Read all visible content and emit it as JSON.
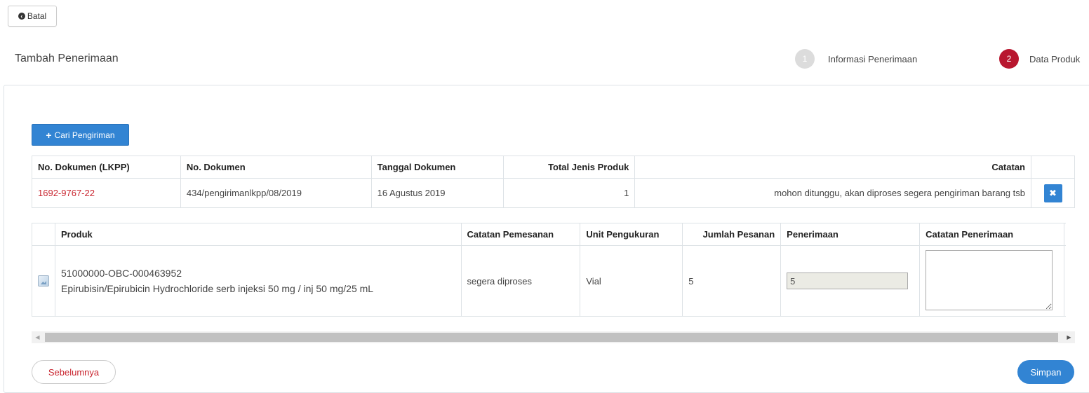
{
  "toolbar": {
    "back_label": "Batal"
  },
  "page": {
    "title": "Tambah Penerimaan"
  },
  "steps": [
    {
      "number": "1",
      "label": "Informasi Penerimaan"
    },
    {
      "number": "2",
      "label": "Data Produk"
    }
  ],
  "search_button": {
    "label": "Cari Pengiriman"
  },
  "documents_table": {
    "headers": [
      "No. Dokumen (LKPP)",
      "No. Dokumen",
      "Tanggal Dokumen",
      "Total Jenis Produk",
      "Catatan"
    ],
    "rows": [
      {
        "lkpp": "1692-9767-22",
        "doc_no": "434/pengirimanlkpp/08/2019",
        "date": "16 Agustus 2019",
        "total": "1",
        "note": "mohon ditunggu, akan diproses segera pengiriman barang tsb"
      }
    ]
  },
  "products_table": {
    "headers": [
      "Produk",
      "Catatan Pemesanan",
      "Unit Pengukuran",
      "Jumlah Pesanan",
      "Penerimaan",
      "Catatan Penerimaan"
    ],
    "rows": [
      {
        "code": "51000000-OBC-000463952",
        "name": "Epirubisin/Epirubicin Hydrochloride serb injeksi 50 mg / inj 50 mg/25 mL",
        "order_note": "segera diproses",
        "unit": "Vial",
        "qty": "5",
        "received": "5",
        "receive_note": ""
      }
    ]
  },
  "footer": {
    "prev_label": "Sebelumnya",
    "save_label": "Simpan"
  },
  "colors": {
    "primary": "#3284d3",
    "accent_red": "#b8172f",
    "link_red": "#c9252f"
  }
}
